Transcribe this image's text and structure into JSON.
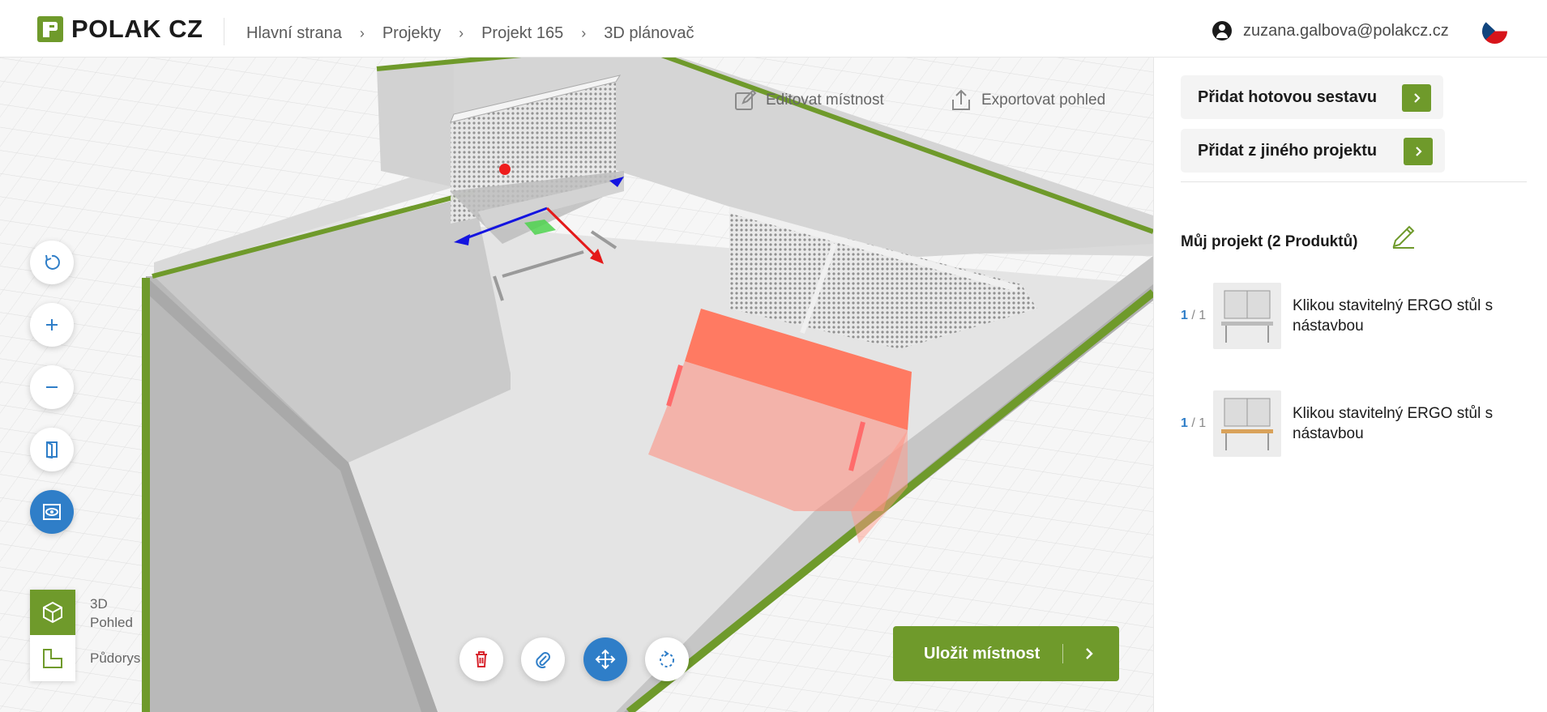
{
  "brand": {
    "name": "POLAK CZ",
    "accent": "#6f9a2b",
    "blue": "#2f7ec8"
  },
  "breadcrumb": [
    "Hlavní strana",
    "Projekty",
    "Projekt 165",
    "3D plánovač"
  ],
  "user": {
    "email": "zuzana.galbova@polakcz.cz",
    "language_flag": "cz-flag-icon"
  },
  "viewport": {
    "edit_room_label": "Editovat místnost",
    "export_view_label": "Exportovat pohled",
    "watermark": "POLAK CZ",
    "left_tools": [
      "reset-view-icon",
      "zoom-in-icon",
      "zoom-out-icon",
      "door-icon",
      "visibility-icon"
    ],
    "view_modes": {
      "three_d": "3D Pohled",
      "plan": "Půdorys"
    },
    "object_tools": [
      "trash-icon",
      "attach-icon",
      "move-icon",
      "rotate-icon"
    ],
    "save_label": "Uložit místnost"
  },
  "sidebar": {
    "add_preset_label": "Přidat hotovou sestavu",
    "add_from_project_label": "Přidat z jiného projektu",
    "project_title": "Můj projekt (2 Produktů)",
    "products": [
      {
        "qty": "1",
        "total": "1",
        "name": "Klikou stavitelný ERGO stůl s nástavbou"
      },
      {
        "qty": "1",
        "total": "1",
        "name": "Klikou stavitelný ERGO stůl s nástavbou"
      }
    ]
  }
}
